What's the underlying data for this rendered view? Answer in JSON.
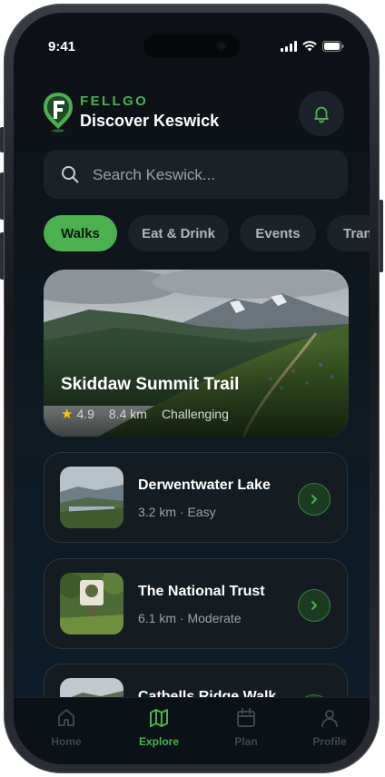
{
  "status_bar": {
    "time": "9:41"
  },
  "header": {
    "brand": "FELLGO",
    "title": "Discover Keswick"
  },
  "search": {
    "placeholder": "Search Keswick..."
  },
  "categories": [
    {
      "label": "Walks",
      "active": true
    },
    {
      "label": "Eat & Drink",
      "active": false
    },
    {
      "label": "Events",
      "active": false
    },
    {
      "label": "Transport",
      "active": false
    }
  ],
  "featured": {
    "title": "Skiddaw Summit Trail",
    "rating": "4.9",
    "distance": "8.4 km",
    "difficulty": "Challenging"
  },
  "walks": [
    {
      "title": "Derwentwater Lake",
      "subtitle": "3.2 km · Easy"
    },
    {
      "title": "The National Trust",
      "subtitle": "6.1 km · Moderate"
    },
    {
      "title": "Catbells Ridge Walk",
      "subtitle": ""
    }
  ],
  "tabbar": [
    {
      "label": "Home",
      "icon": "home-icon",
      "active": false
    },
    {
      "label": "Explore",
      "icon": "map-icon",
      "active": true
    },
    {
      "label": "Plan",
      "icon": "calendar-icon",
      "active": false
    },
    {
      "label": "Profile",
      "icon": "profile-icon",
      "active": false
    }
  ],
  "colors": {
    "accent": "#4caf50",
    "background": "#0d1014",
    "card": "#141b21"
  }
}
